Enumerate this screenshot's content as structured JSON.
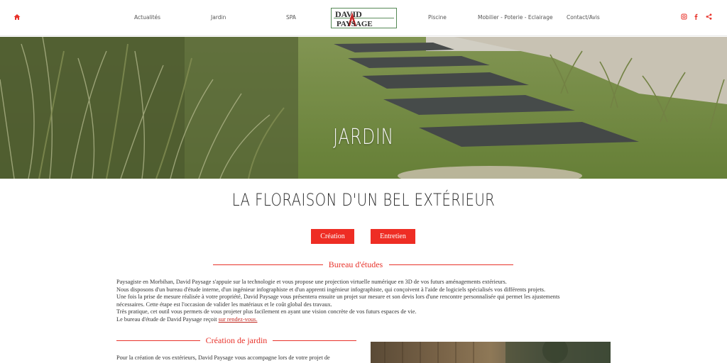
{
  "header": {
    "logo_line1": "DAVID",
    "logo_line2": "PAYSAGE",
    "nav": [
      {
        "label": "Actualités"
      },
      {
        "label": "Jardin"
      },
      {
        "label": "SPA"
      },
      {
        "label": "Piscine"
      },
      {
        "label": "Mobilier - Poterie - Eclairage"
      },
      {
        "label": "Contact/Avis"
      }
    ]
  },
  "hero": {
    "title": "JARDIN"
  },
  "main": {
    "title": "LA FLORAISON D'UN BEL EXTÉRIEUR",
    "buttons": [
      {
        "label": "Création"
      },
      {
        "label": "Entretien"
      }
    ]
  },
  "bureau": {
    "heading": "Bureau d'études",
    "lines": [
      "Paysagiste en Morbihan, David Paysage s'appuie sur la technologie et vous propose une projection virtuelle numérique en 3D de vos futurs aménagements extérieurs.",
      "Nous disposons d'un bureau d'étude interne, d'un ingénieur infographiste et d'un apprenti ingénieur infographiste, qui conçoivent à l'aide de logiciels spécialisés vos différents projets.",
      "Une fois la prise de mesure réalisée à votre propriété, David Paysage vous présentera ensuite un projet sur mesure et son devis lors d'une rencontre personnalisée qui permet les ajustements",
      "nécessaires. Cette étape est l'occasion de valider les matériaux et le coût global des travaux.",
      "Très pratique, cet outil vous permets de vous projeter plus facilement en ayant une vision concrète de vos futurs espaces de vie."
    ],
    "last_line_text": "Le bureau d'étude de David Paysage reçoit ",
    "last_line_link": "sur rendez-vous."
  },
  "creation": {
    "heading": "Création de jardin",
    "intro": "Pour la création de vos extérieurs, David Paysage vous accompagne lors de votre projet de"
  },
  "colors": {
    "accent": "#ee2d24",
    "text": "#333333"
  }
}
